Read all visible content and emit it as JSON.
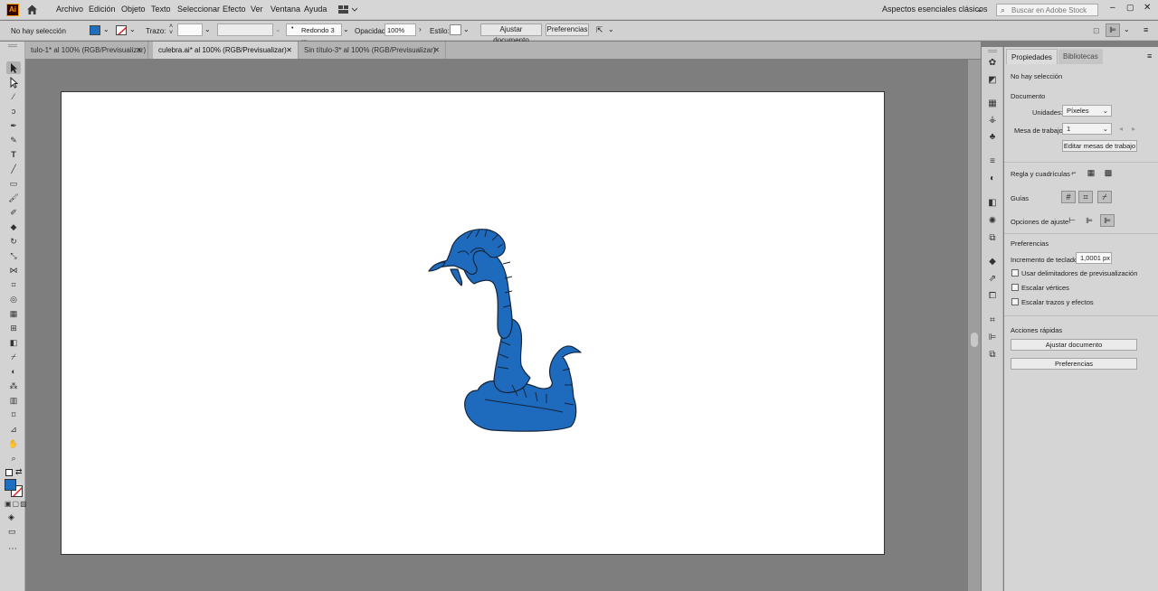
{
  "menubar": {
    "app_icon": "Ai",
    "items": [
      "Archivo",
      "Edición",
      "Objeto",
      "Texto",
      "Seleccionar",
      "Efecto",
      "Ver",
      "Ventana",
      "Ayuda"
    ],
    "workspace": "Aspectos esenciales clásicos",
    "search_placeholder": "Buscar en Adobe Stock"
  },
  "controlbar": {
    "selection": "No hay selección",
    "fill_color": "#1f6fc0",
    "stroke_label": "Trazo:",
    "brush": "Redondo 3 ...",
    "opacity_label": "Opacidad:",
    "opacity_value": "100%",
    "style_label": "Estilo:",
    "fit_document": "Ajustar documento",
    "preferences": "Preferencias"
  },
  "tabs": [
    {
      "label": "tulo-1* al 100% (RGB/Previsualizar)",
      "active": false
    },
    {
      "label": "culebra.ai* al 100% (RGB/Previsualizar)",
      "active": true
    },
    {
      "label": "Sin título-3* al 100% (RGB/Previsualizar)",
      "active": false
    }
  ],
  "canvas": {
    "artwork": "snake",
    "fill_color": "#1e6bbd",
    "stroke_color": "#14243b"
  },
  "panel": {
    "tab_properties": "Propiedades",
    "tab_libraries": "Bibliotecas",
    "no_selection": "No hay selección",
    "document_heading": "Documento",
    "units_label": "Unidades:",
    "units_value": "Píxeles",
    "artboard_label": "Mesa de trabajo:",
    "artboard_value": "1",
    "edit_artboards": "Editar mesas de trabajo",
    "rulers_grids": "Regla y cuadrículas",
    "guides": "Guías",
    "snap_options": "Opciones de ajuste",
    "preferences_heading": "Preferencias",
    "keyboard_increment_label": "Incremento de teclado:",
    "keyboard_increment_value": "1,0001 px",
    "use_preview_bounds": "Usar delimitadores de previsualización",
    "scale_corners": "Escalar vértices",
    "scale_strokes": "Escalar trazos y efectos",
    "quick_actions": "Acciones rápidas",
    "fit_document": "Ajustar documento",
    "preferences": "Preferencias"
  }
}
